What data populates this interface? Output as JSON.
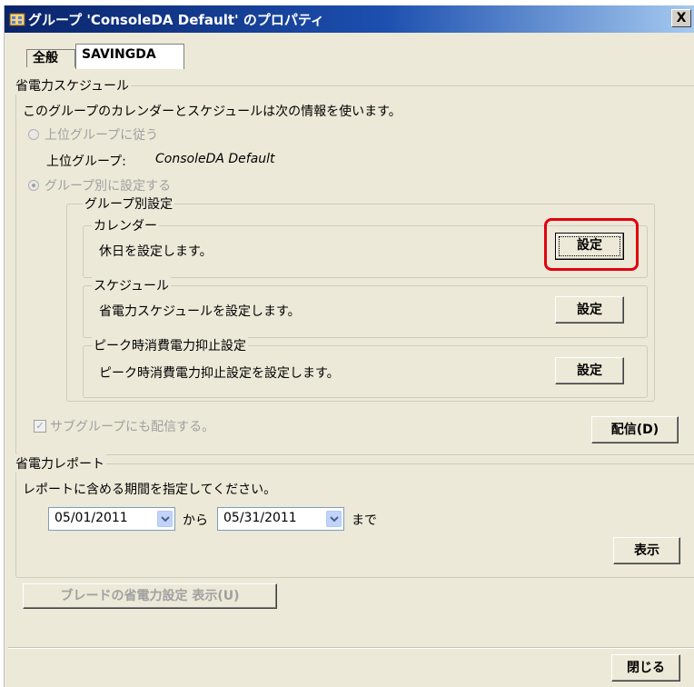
{
  "window": {
    "title": "グループ 'ConsoleDA Default' のプロパティ",
    "close_glyph": "X"
  },
  "tabs": [
    {
      "label": "全般"
    },
    {
      "label": "SAVINGDA"
    }
  ],
  "power_schedule": {
    "group_label": "省電力スケジュール",
    "description": "このグループのカレンダーとスケジュールは次の情報を使います。",
    "option_parent": "上位グループに従う",
    "parent_group_label": "上位グループ:",
    "parent_group_name": "ConsoleDA Default",
    "option_per_group": "グループ別に設定する",
    "per_group_settings": {
      "label": "グループ別設定",
      "calendar": {
        "label": "カレンダー",
        "description": "休日を設定します。",
        "button": "設定"
      },
      "schedule": {
        "label": "スケジュール",
        "description": "省電力スケジュールを設定します。",
        "button": "設定"
      },
      "peak": {
        "label": "ピーク時消費電力抑止設定",
        "description": "ピーク時消費電力抑止設定を設定します。",
        "button": "設定"
      }
    },
    "subgroup_checkbox": "サブグループにも配信する。",
    "deliver_button": "配信(D)"
  },
  "power_report": {
    "group_label": "省電力レポート",
    "description": "レポートに含める期間を指定してください。",
    "from_date": "05/01/2011",
    "from_label": "から",
    "to_date": "05/31/2011",
    "to_label": "まで",
    "show_button": "表示"
  },
  "blade_button": "ブレードの省電力設定 表示(U)",
  "close_button": "閉じる",
  "colors": {
    "highlight": "#e3000f",
    "titlebar": "#0a246a"
  }
}
